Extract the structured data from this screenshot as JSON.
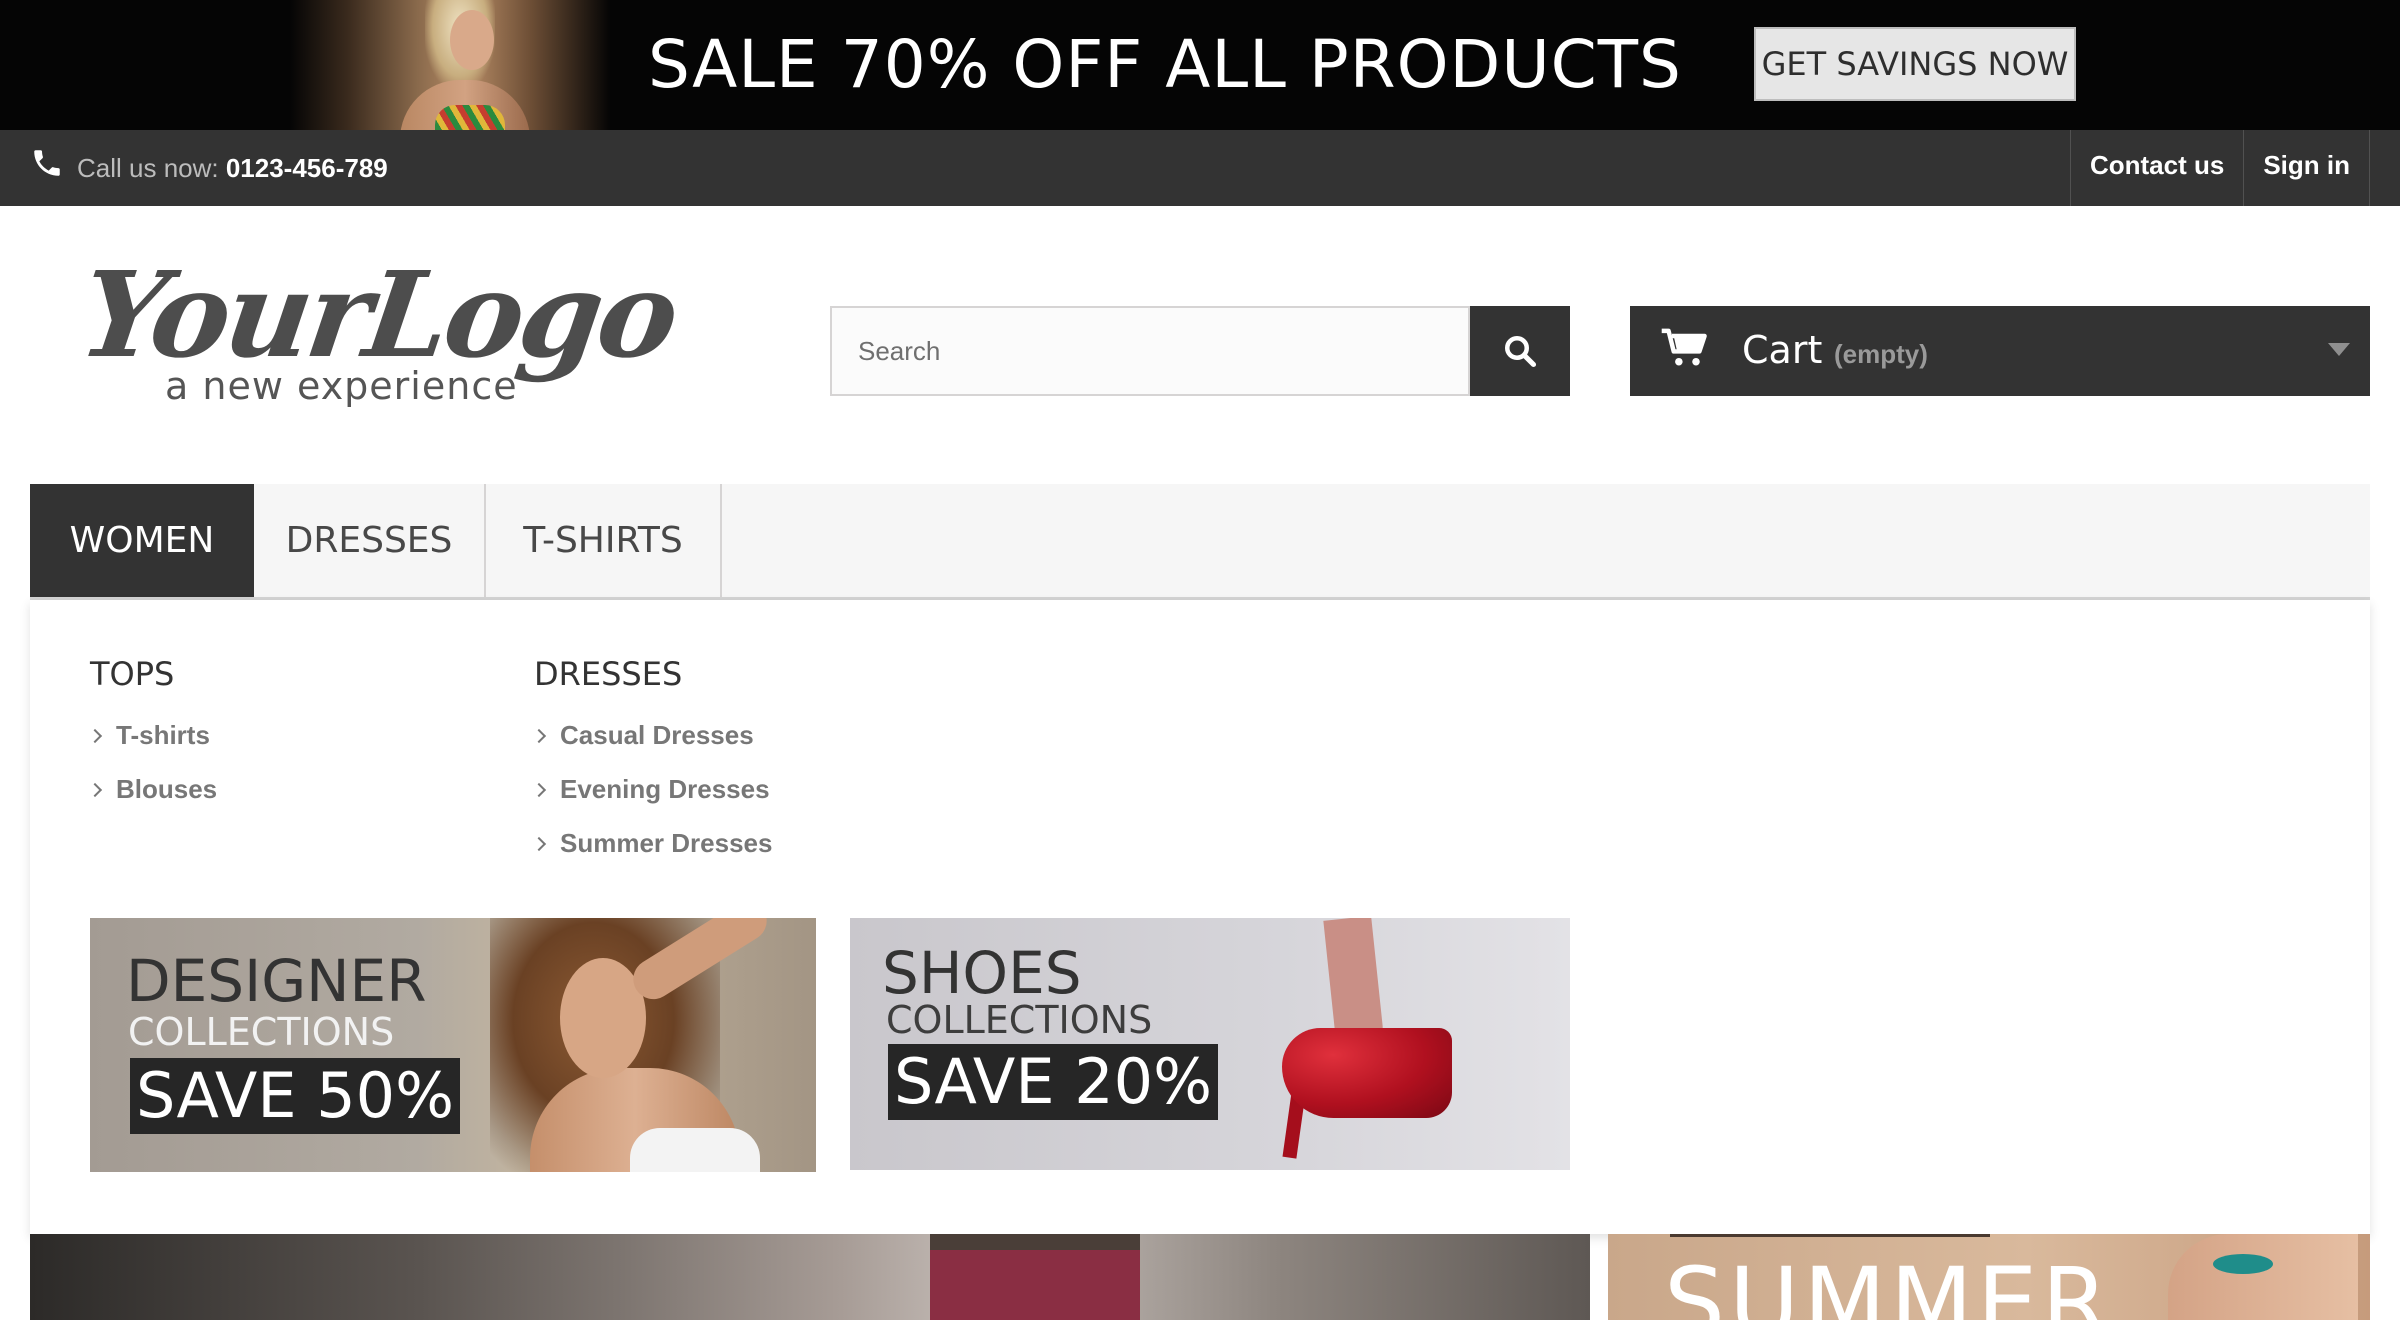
{
  "promo_banner": {
    "headline": "SALE 70% OFF ALL PRODUCTS",
    "cta_label": "GET SAVINGS NOW"
  },
  "topbar": {
    "call_prefix": "Call us now: ",
    "phone_number": "0123-456-789",
    "links": [
      "Contact us",
      "Sign in"
    ]
  },
  "header": {
    "logo_main": "YourLogo",
    "logo_tagline": "a new experience",
    "search_placeholder": "Search",
    "cart_label": "Cart",
    "cart_status": "(empty)"
  },
  "menu": {
    "tabs": [
      "WOMEN",
      "DRESSES",
      "T-SHIRTS"
    ],
    "active_tab": "WOMEN"
  },
  "dropdown": {
    "columns": [
      {
        "heading": "TOPS",
        "items": [
          "T-shirts",
          "Blouses"
        ]
      },
      {
        "heading": "DRESSES",
        "items": [
          "Casual Dresses",
          "Evening Dresses",
          "Summer Dresses"
        ]
      }
    ],
    "cards": [
      {
        "title": "DESIGNER",
        "subtitle": "COLLECTIONS",
        "offer": "SAVE 50%"
      },
      {
        "title": "SHOES",
        "subtitle": "COLLECTIONS",
        "offer": "SAVE 20%"
      }
    ]
  },
  "bottom_banner": {
    "summer_text": "SUMMER"
  },
  "colors": {
    "dark": "#333333",
    "promo_bg": "#050505",
    "menu_bg": "#f6f6f6",
    "muted_text": "#777777"
  }
}
